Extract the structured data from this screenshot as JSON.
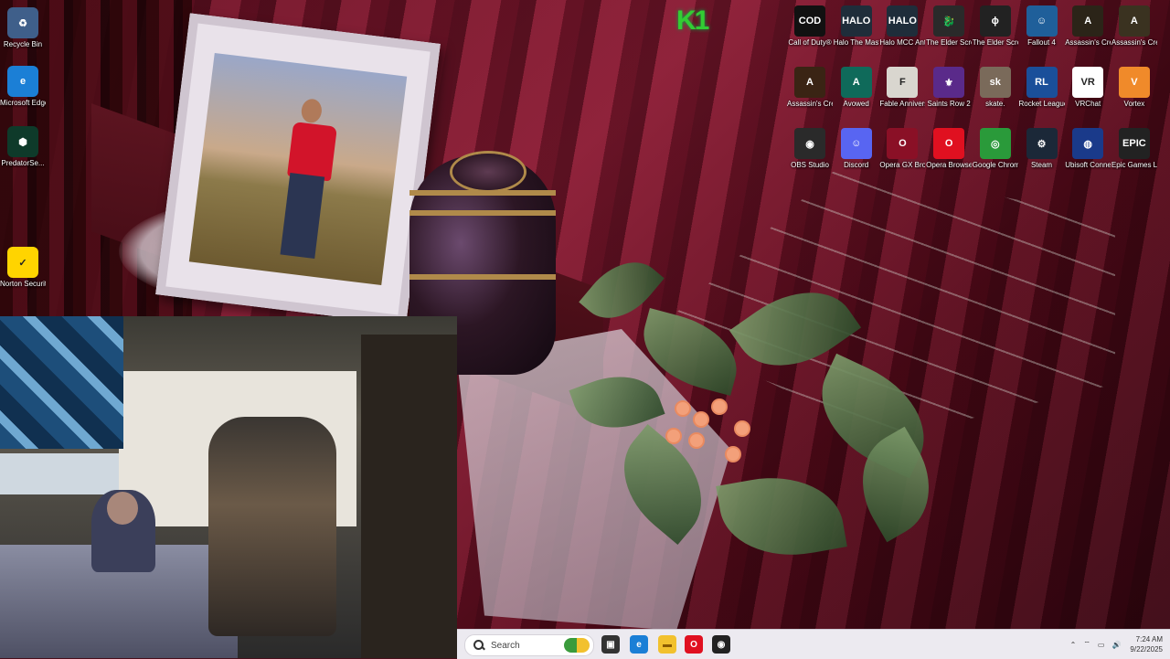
{
  "desktop": {
    "left_icons": [
      {
        "name": "recycle-bin",
        "label": "Recycle Bin",
        "glyph": "♻",
        "bg": "#3f5f8a"
      },
      {
        "name": "microsoft-edge",
        "label": "Microsoft Edge",
        "glyph": "e",
        "bg": "#1b7fd6"
      },
      {
        "name": "predatorsense",
        "label": "PredatorSe...",
        "glyph": "⬢",
        "bg": "#0e3a2a"
      },
      {
        "name": "norton",
        "label": "Norton Security Ultra",
        "glyph": "✓",
        "bg": "#ffd400"
      }
    ],
    "grid_icons": [
      {
        "name": "call-of-duty",
        "label": "Call of Duty®",
        "glyph": "COD",
        "bg": "#111111"
      },
      {
        "name": "halo-mc",
        "label": "Halo The Master Chi...",
        "glyph": "HALO",
        "bg": "#1f2d3a"
      },
      {
        "name": "halo-mcc",
        "label": "Halo MCC Anti-Che...",
        "glyph": "HALO",
        "bg": "#1f2d3a"
      },
      {
        "name": "elder-scrolls",
        "label": "The Elder Scrolls ...",
        "glyph": "🐉",
        "bg": "#2a2a2a"
      },
      {
        "name": "elder-scrolls-iv",
        "label": "The Elder Scrolls IV ...",
        "glyph": "ɸ",
        "bg": "#222222"
      },
      {
        "name": "fallout-4",
        "label": "Fallout 4",
        "glyph": "☺",
        "bg": "#1f5f9a"
      },
      {
        "name": "assassins-creed-o",
        "label": "Assassin's Creed O...",
        "glyph": "A",
        "bg": "#2b2418"
      },
      {
        "name": "assassins-creed-origins",
        "label": "Assassin's Creed Origins",
        "glyph": "A",
        "bg": "#3a3220"
      },
      {
        "name": "assassins-creed-mirage",
        "label": "Assassin's Creed Mirage",
        "glyph": "A",
        "bg": "#3a2414"
      },
      {
        "name": "avowed",
        "label": "Avowed",
        "glyph": "A",
        "bg": "#0f6a5a"
      },
      {
        "name": "fable-anniversary",
        "label": "Fable Anniversary",
        "glyph": "F",
        "bg": "#d9d6cf"
      },
      {
        "name": "saints-row-2",
        "label": "Saints Row 2",
        "glyph": "⚜",
        "bg": "#5a2a8a"
      },
      {
        "name": "skate",
        "label": "skate.",
        "glyph": "sk",
        "bg": "#7a6a5a"
      },
      {
        "name": "rocket-league",
        "label": "Rocket League®",
        "glyph": "RL",
        "bg": "#1a4f9a"
      },
      {
        "name": "vrchat",
        "label": "VRChat",
        "glyph": "VR",
        "bg": "#ffffff"
      },
      {
        "name": "vortex",
        "label": "Vortex",
        "glyph": "V",
        "bg": "#f08a2a"
      },
      {
        "name": "obs-studio",
        "label": "OBS Studio",
        "glyph": "◉",
        "bg": "#2a2a2a"
      },
      {
        "name": "discord",
        "label": "Discord",
        "glyph": "☺",
        "bg": "#5865f2"
      },
      {
        "name": "opera-gx",
        "label": "Opera GX Browser",
        "glyph": "O",
        "bg": "#8a1026"
      },
      {
        "name": "opera",
        "label": "Opera Browser",
        "glyph": "O",
        "bg": "#e01020"
      },
      {
        "name": "google-chrome",
        "label": "Google Chrome",
        "glyph": "◎",
        "bg": "#2a9a3a"
      },
      {
        "name": "steam",
        "label": "Steam",
        "glyph": "⚙",
        "bg": "#1b2838"
      },
      {
        "name": "ubisoft-connect",
        "label": "Ubisoft Connect",
        "glyph": "◍",
        "bg": "#1a3a8a"
      },
      {
        "name": "epic-games",
        "label": "Epic Games Launcher",
        "glyph": "EPIC",
        "bg": "#222222"
      }
    ]
  },
  "overlay": {
    "k1_text": "K1"
  },
  "taskbar": {
    "search_placeholder": "Search",
    "apps": [
      {
        "name": "taskview",
        "glyph": "▣",
        "bg": "#333333",
        "fg": "#ffffff"
      },
      {
        "name": "edge",
        "glyph": "e",
        "bg": "#1b7fd6",
        "fg": "#ffffff"
      },
      {
        "name": "file-explorer",
        "glyph": "▬",
        "bg": "#f2c12e",
        "fg": "#8a5a00"
      },
      {
        "name": "opera",
        "glyph": "O",
        "bg": "#e01020",
        "fg": "#ffffff"
      },
      {
        "name": "obs",
        "glyph": "◉",
        "bg": "#222222",
        "fg": "#ffffff"
      }
    ],
    "tray": {
      "chevron": "⌃",
      "network": "⌔",
      "volume": "🔊",
      "battery": "▭",
      "time": "7:24 AM",
      "date": "9/22/2025"
    }
  }
}
